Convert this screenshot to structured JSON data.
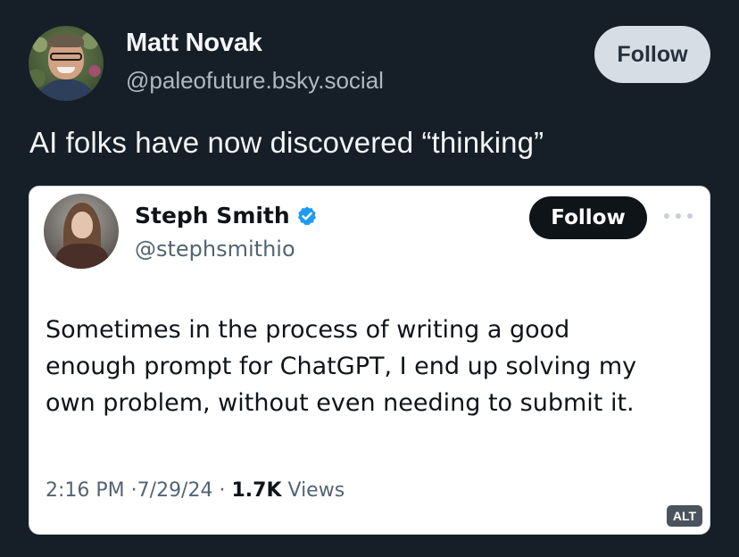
{
  "post": {
    "author_name": "Matt Novak",
    "author_handle": "@paleofuture.bsky.social",
    "follow_label": "Follow",
    "text": "AI folks have now discovered “thinking”"
  },
  "embedded_tweet": {
    "author_name": "Steph Smith",
    "author_handle": "@stephsmithio",
    "verified_icon": "verified-badge-icon",
    "verified_color": "#1d9bf0",
    "follow_label": "Follow",
    "more_icon": "more-options-icon",
    "text_lines": [
      "Sometimes in the process of writing a good",
      "enough prompt for ChatGPT, I end up solving my",
      "own problem, without even needing to submit it."
    ],
    "time": "2:16 PM",
    "separator": "·",
    "date": "7/29/24",
    "views_count": "1.7K",
    "views_label": "Views"
  },
  "alt_badge": "ALT"
}
